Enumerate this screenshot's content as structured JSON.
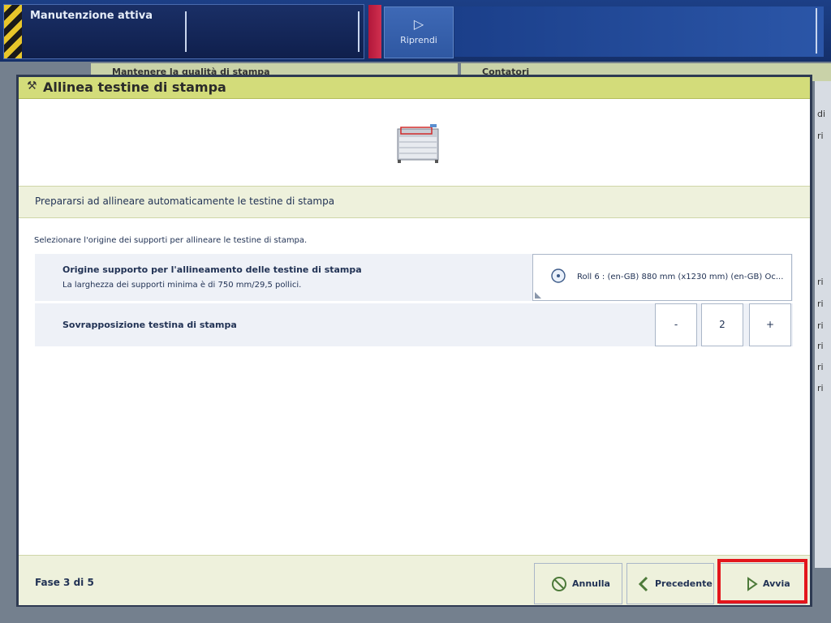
{
  "topbar": {
    "maintenance_title": "Manutenzione attiva",
    "resume_label": "Riprendi"
  },
  "background": {
    "tab_left": "Mantenere la qualità di stampa",
    "tab_right": "Contatori",
    "right_col_letters": [
      "di",
      "ri",
      "ri",
      "ri",
      "ri",
      "ri",
      "ri",
      "ri"
    ]
  },
  "dialog": {
    "title": "Allinea testine di stampa",
    "section_title": "Prepararsi ad allineare automaticamente le testine di stampa",
    "instruction": "Selezionare l'origine dei supporti per allineare le testine di stampa.",
    "media_source": {
      "label": "Origine supporto per l'allineamento delle testine di stampa",
      "sublabel": "La larghezza dei supporti minima è di 750 mm/29,5 pollici.",
      "value": "Roll 6 : (en-GB) 880 mm (x1230 mm) (en-GB) Oc..."
    },
    "overlap": {
      "label": "Sovrapposizione testina di stampa",
      "decrement": "-",
      "value": "2",
      "increment": "+"
    },
    "footer": {
      "step": "Fase 3 di 5",
      "cancel": "Annulla",
      "previous": "Precedente",
      "start": "Avvia"
    }
  },
  "colors": {
    "header_accent": "#d3dc7a",
    "highlight": "#e3161c",
    "topbar": "#1c3f86"
  }
}
